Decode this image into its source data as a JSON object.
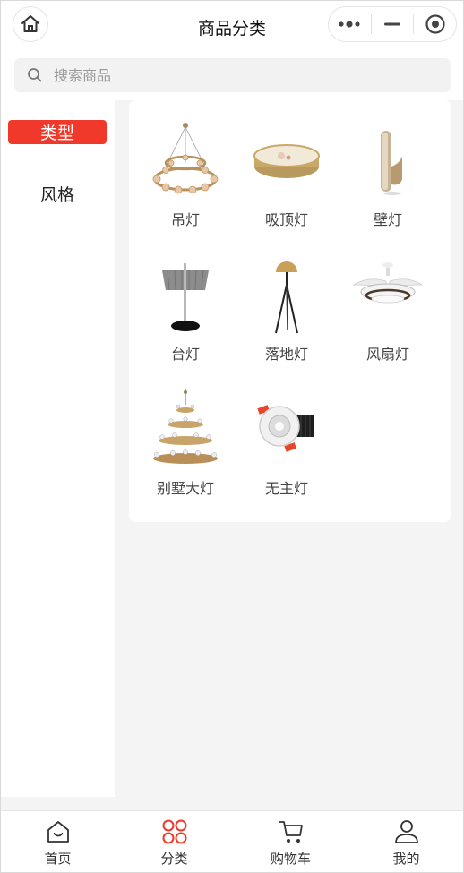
{
  "header": {
    "title": "商品分类",
    "home_icon": "home-icon",
    "capsule": [
      "more-icon",
      "minimize-icon",
      "close-target-icon"
    ]
  },
  "search": {
    "placeholder": "搜索商品",
    "value": "",
    "icon": "search-icon"
  },
  "sidebar": {
    "items": [
      {
        "label": "类型",
        "active": true
      },
      {
        "label": "风格",
        "active": false
      }
    ]
  },
  "categories": [
    {
      "label": "吊灯",
      "icon": "chandelier-ring-image"
    },
    {
      "label": "吸顶灯",
      "icon": "ceiling-lamp-image"
    },
    {
      "label": "壁灯",
      "icon": "wall-lamp-image"
    },
    {
      "label": "台灯",
      "icon": "table-lamp-image"
    },
    {
      "label": "落地灯",
      "icon": "floor-lamp-image"
    },
    {
      "label": "风扇灯",
      "icon": "fan-lamp-image"
    },
    {
      "label": "别墅大灯",
      "icon": "villa-chandelier-image"
    },
    {
      "label": "无主灯",
      "icon": "downlight-image"
    }
  ],
  "tabbar": {
    "items": [
      {
        "label": "首页",
        "icon": "home-bag-icon",
        "active": false
      },
      {
        "label": "分类",
        "icon": "category-icon",
        "active": true
      },
      {
        "label": "购物车",
        "icon": "cart-icon",
        "active": false
      },
      {
        "label": "我的",
        "icon": "user-icon",
        "active": false
      }
    ]
  },
  "colors": {
    "accent": "#f0392b",
    "background": "#f4f4f4"
  }
}
